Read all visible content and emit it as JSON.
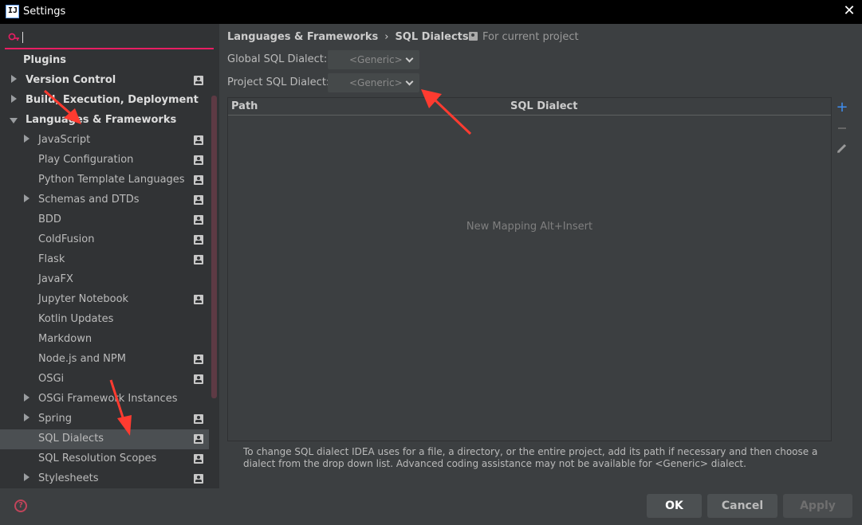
{
  "window": {
    "title": "Settings",
    "close_glyph": "✕",
    "app_icon_text": "IJ"
  },
  "search": {
    "value": "",
    "placeholder": ""
  },
  "sidebar": {
    "items": [
      {
        "label": "Plugins",
        "level": 0,
        "bold": true,
        "arrow": "none",
        "project_icon": false
      },
      {
        "label": "Version Control",
        "level": 0,
        "bold": true,
        "arrow": "right",
        "project_icon": true
      },
      {
        "label": "Build, Execution, Deployment",
        "level": 0,
        "bold": true,
        "arrow": "right",
        "project_icon": false
      },
      {
        "label": "Languages & Frameworks",
        "level": 0,
        "bold": true,
        "arrow": "down",
        "project_icon": false
      },
      {
        "label": "JavaScript",
        "level": 1,
        "arrow": "right",
        "project_icon": true
      },
      {
        "label": "Play Configuration",
        "level": 1,
        "arrow": "none",
        "project_icon": true
      },
      {
        "label": "Python Template Languages",
        "level": 1,
        "arrow": "none",
        "project_icon": true
      },
      {
        "label": "Schemas and DTDs",
        "level": 1,
        "arrow": "right",
        "project_icon": true
      },
      {
        "label": "BDD",
        "level": 1,
        "arrow": "none",
        "project_icon": true
      },
      {
        "label": "ColdFusion",
        "level": 1,
        "arrow": "none",
        "project_icon": true
      },
      {
        "label": "Flask",
        "level": 1,
        "arrow": "none",
        "project_icon": true
      },
      {
        "label": "JavaFX",
        "level": 1,
        "arrow": "none",
        "project_icon": false
      },
      {
        "label": "Jupyter Notebook",
        "level": 1,
        "arrow": "none",
        "project_icon": true
      },
      {
        "label": "Kotlin Updates",
        "level": 1,
        "arrow": "none",
        "project_icon": false
      },
      {
        "label": "Markdown",
        "level": 1,
        "arrow": "none",
        "project_icon": false
      },
      {
        "label": "Node.js and NPM",
        "level": 1,
        "arrow": "none",
        "project_icon": true
      },
      {
        "label": "OSGi",
        "level": 1,
        "arrow": "none",
        "project_icon": true
      },
      {
        "label": "OSGi Framework Instances",
        "level": 1,
        "arrow": "right",
        "project_icon": false
      },
      {
        "label": "Spring",
        "level": 1,
        "arrow": "right",
        "project_icon": true
      },
      {
        "label": "SQL Dialects",
        "level": 1,
        "arrow": "none",
        "project_icon": true,
        "selected": true
      },
      {
        "label": "SQL Resolution Scopes",
        "level": 1,
        "arrow": "none",
        "project_icon": true
      },
      {
        "label": "Stylesheets",
        "level": 1,
        "arrow": "right",
        "project_icon": true
      }
    ]
  },
  "breadcrumb": {
    "parent": "Languages & Frameworks",
    "separator": "›",
    "current": "SQL Dialects",
    "scope_label": "For current project"
  },
  "global_dialect": {
    "label": "Global SQL Dialect:",
    "value": "<Generic>"
  },
  "project_dialect": {
    "label": "Project SQL Dialect:",
    "value": "<Generic>"
  },
  "table": {
    "columns": [
      "Path",
      "SQL Dialect"
    ],
    "empty_text": "New Mapping Alt+Insert",
    "add_glyph": "+"
  },
  "hint": "To change SQL dialect IDEA uses for a file, a directory, or the entire project, add its path if necessary and then choose a dialect from the drop down list. Advanced coding assistance may not be available for <Generic> dialect.",
  "buttons": {
    "ok": "OK",
    "cancel": "Cancel",
    "apply": "Apply",
    "help_glyph": "?"
  },
  "colors": {
    "accent_search": "#e91e63",
    "add_icon": "#3f8ef0",
    "annotation_arrow": "#ff3b30"
  }
}
